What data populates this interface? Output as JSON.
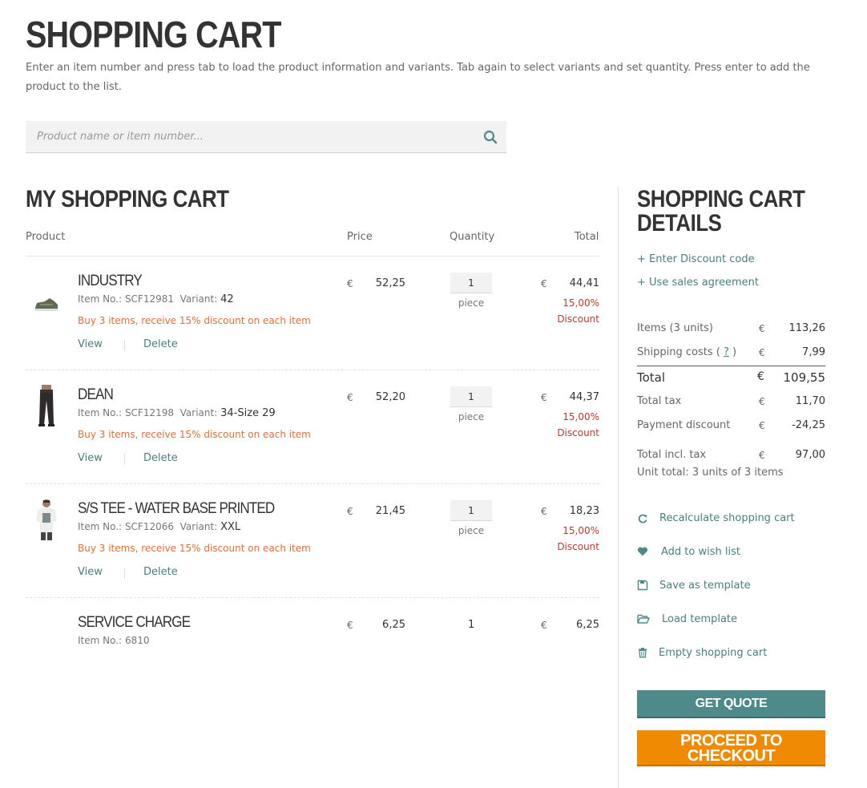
{
  "page": {
    "title": "SHOPPING CART",
    "intro": "Enter an item number and press tab to load the product information and variants. Tab again to select variants and set quantity. Press enter to add the product to the list."
  },
  "search": {
    "placeholder": "Product name or item number...",
    "icon": "search-icon"
  },
  "cart": {
    "title": "MY SHOPPING CART",
    "columns": {
      "product": "Product",
      "price": "Price",
      "quantity": "Quantity",
      "total": "Total"
    },
    "currency": "€",
    "item_no_label": "Item No.:",
    "variant_label": "Variant:",
    "view_label": "View",
    "delete_label": "Delete",
    "unit_label": "piece",
    "discount_label": "Discount",
    "items": [
      {
        "name": "INDUSTRY",
        "item_no": "SCF12981",
        "variant": "42",
        "promo": "Buy 3 items, receive 15% discount on each item",
        "price": "52,25",
        "qty": "1",
        "total": "44,41",
        "discount_pct": "15,00%",
        "image": "sneaker"
      },
      {
        "name": "DEAN",
        "item_no": "SCF12198",
        "variant": "34-Size 29",
        "promo": "Buy 3 items, receive 15% discount on each item",
        "price": "52,20",
        "qty": "1",
        "total": "44,37",
        "discount_pct": "15,00%",
        "image": "trousers"
      },
      {
        "name": "S/S TEE - WATER BASE PRINTED",
        "item_no": "SCF12066",
        "variant": "XXL",
        "promo": "Buy 3 items, receive 15% discount on each item",
        "price": "21,45",
        "qty": "1",
        "total": "18,23",
        "discount_pct": "15,00%",
        "image": "t-shirt"
      }
    ],
    "service": {
      "name": "SERVICE CHARGE",
      "item_no": "6810",
      "price": "6,25",
      "qty": "1",
      "total": "6,25"
    }
  },
  "details": {
    "title_line1": "SHOPPING CART",
    "title_line2": "DETAILS",
    "discount_link": "+ Enter Discount code",
    "agreement_link": "+ Use sales agreement",
    "rows": {
      "items_label": "Items (3 units)",
      "items_value": "113,26",
      "shipping_label": "Shipping costs (",
      "shipping_help": "?",
      "shipping_close": ")",
      "shipping_value": "7,99",
      "total_label": "Total",
      "total_value": "109,55",
      "tax_label": "Total tax",
      "tax_value": "11,70",
      "payment_discount_label": "Payment discount",
      "payment_discount_value": "-24,25",
      "incl_tax_label": "Total incl. tax",
      "incl_tax_value": "97,00",
      "unit_total": "Unit total: 3 units of 3 items"
    },
    "tools": {
      "recalculate": "Recalculate shopping cart",
      "wishlist": "Add to wish list",
      "save_template": "Save as template",
      "load_template": "Load template",
      "empty_cart": "Empty shopping cart"
    },
    "buttons": {
      "quote": "GET QUOTE",
      "checkout_line1": "PROCEED TO",
      "checkout_line2": "CHECKOUT"
    }
  },
  "colors": {
    "accent": "#4e8a89",
    "checkout": "#f08a00",
    "promo": "#e07035",
    "discount": "#c0392b"
  }
}
